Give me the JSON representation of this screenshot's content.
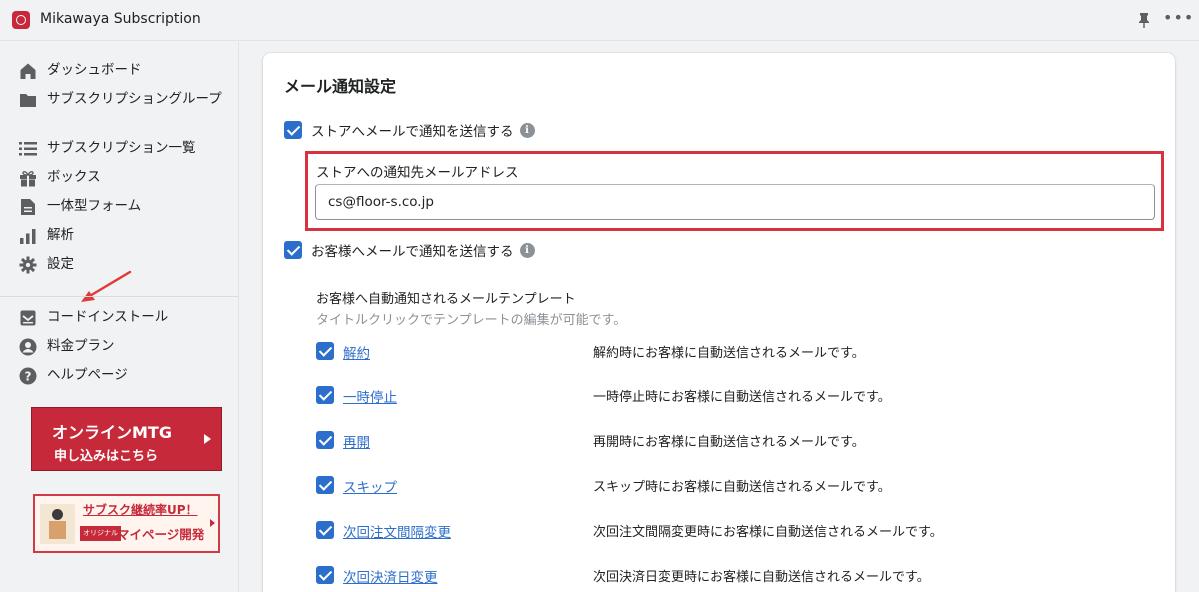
{
  "app": {
    "title": "Mikawaya Subscription"
  },
  "sidebar": {
    "items": [
      {
        "label": "ダッシュボード",
        "icon": "home-icon"
      },
      {
        "label": "サブスクリプショングループ",
        "icon": "folder-icon"
      },
      {
        "label": "サブスクリプション一覧",
        "icon": "list-icon"
      },
      {
        "label": "ボックス",
        "icon": "gift-icon"
      },
      {
        "label": "一体型フォーム",
        "icon": "document-icon"
      },
      {
        "label": "解析",
        "icon": "analytics-icon"
      },
      {
        "label": "設定",
        "icon": "gear-icon"
      }
    ],
    "secondary_items": [
      {
        "label": "コードインストール",
        "icon": "code-install-icon"
      },
      {
        "label": "料金プラン",
        "icon": "user-circle-icon"
      },
      {
        "label": "ヘルプページ",
        "icon": "question-icon"
      }
    ],
    "banner_mtg": {
      "line1": "オンラインMTG",
      "line2": "申し込みはこちら"
    },
    "banner_mypage": {
      "line1": "サブスク継続率UP！",
      "tag": "オリジナル",
      "line2": "マイページ開発"
    }
  },
  "main": {
    "title": "メール通知設定",
    "store_notify": {
      "label": "ストアへメールで通知を送信する",
      "checked": true
    },
    "store_email": {
      "label": "ストアへの通知先メールアドレス",
      "value": "cs@floor-s.co.jp"
    },
    "customer_notify": {
      "label": "お客様へメールで通知を送信する",
      "checked": true
    },
    "templates": {
      "heading": "お客様へ自動通知されるメールテンプレート",
      "subheading": "タイトルクリックでテンプレートの編集が可能です。",
      "items": [
        {
          "name": "解約",
          "description": "解約時にお客様に自動送信されるメールです。",
          "checked": true
        },
        {
          "name": "一時停止",
          "description": "一時停止時にお客様に自動送信されるメールです。",
          "checked": true
        },
        {
          "name": "再開",
          "description": "再開時にお客様に自動送信されるメールです。",
          "checked": true
        },
        {
          "name": "スキップ",
          "description": "スキップ時にお客様に自動送信されるメールです。",
          "checked": true
        },
        {
          "name": "次回注文間隔変更",
          "description": "次回注文間隔変更時にお客様に自動送信されるメールです。",
          "checked": true
        },
        {
          "name": "次回決済日変更",
          "description": "次回決済日変更時にお客様に自動送信されるメールです。",
          "checked": true
        }
      ]
    }
  },
  "colors": {
    "accent": "#2c6ecb",
    "highlight": "#d8313f",
    "brand": "#c62a3a"
  }
}
